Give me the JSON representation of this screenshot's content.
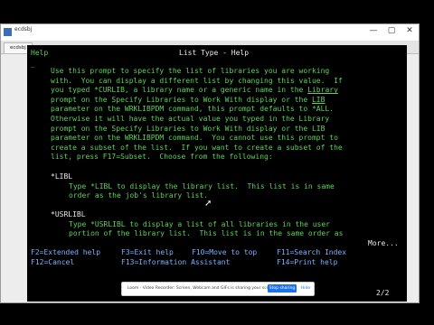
{
  "window": {
    "title": "ecdsbj"
  },
  "tab": {
    "label": "ecdsbj"
  },
  "controls": {
    "minimize": "—",
    "maximize": "▢",
    "close": "✕"
  },
  "screen": {
    "help_label": "Help",
    "title": "List Type - Help",
    "prompt_marker": "_",
    "paragraph": [
      "Use this prompt to specify the list of libraries you are working",
      "with.  You can display a different list by changing this value.  If",
      "parameter on the WRKLIBPDM command, this prompt defaults to *ALL.",
      "Otherwise it will have the actual value you typed in the Library",
      "prompt on the Specify Libraries to Work With display or the LIB",
      "parameter on the WRKLIBPDM command.  You cannot use this prompt to",
      "create a subset of the list.  If you want to create a subset of the",
      "list, press F17=Subset.  Choose from the following:"
    ],
    "line3a": "you typed *CURLIB, a library name or a generic name in the ",
    "line3_link": "Library",
    "line4a": "prompt on the Specify Libraries to Work With display or the ",
    "line4_link": "LIB",
    "options": [
      {
        "name": "*LIBL",
        "lines": [
          "Type *LIBL to display the library list.  This list is in same",
          "order as the job's library list."
        ]
      },
      {
        "name": "*USRLIBL",
        "lines": [
          "Type *USRLIBL to display a list of all libraries in the user",
          "portion of the library list.  This list is in the same order as"
        ]
      }
    ],
    "more": "More...",
    "fkeys_row1": [
      "F2=Extended help",
      "F3=Exit help",
      "F10=Move to top",
      "F11=Search Index"
    ],
    "fkeys_row2": [
      "F12=Cancel",
      "F13=Information Assistant",
      "F14=Print help"
    ],
    "page_indicator": "2/2"
  },
  "share_bar": {
    "message": "Loom - Video Recorder: Screen, Webcam and GIFs is sharing your screen.",
    "stop_label": "Stop sharing",
    "hide_label": "Hide"
  }
}
